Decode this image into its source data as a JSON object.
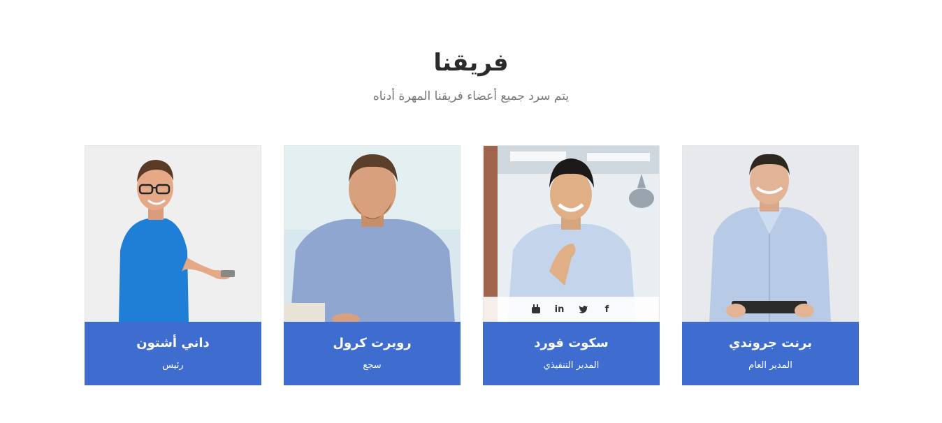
{
  "section": {
    "title": "فريقنا",
    "subtitle": "يتم سرد جميع أعضاء فريقنا المهرة أدناه"
  },
  "members": [
    {
      "name": "برنت جروندي",
      "role": "المدير العام"
    },
    {
      "name": "سكوت فورد",
      "role": "المدير التنفيذي"
    },
    {
      "name": "روبرت كرول",
      "role": "سجع"
    },
    {
      "name": "داني أشتون",
      "role": "رئيس"
    }
  ],
  "social_icons": {
    "facebook": "f",
    "twitter": "twitter-bird",
    "linkedin": "in",
    "youtube": "youtube"
  },
  "colors": {
    "card_info_bg": "#3f6ccf",
    "title": "#2b2b2b",
    "subtitle": "#777777"
  }
}
